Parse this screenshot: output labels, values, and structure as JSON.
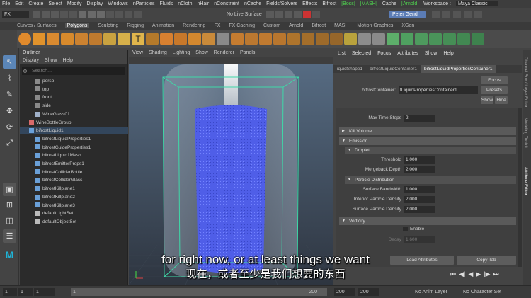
{
  "menubar": {
    "items": [
      "File",
      "Edit",
      "Create",
      "Select",
      "Modify",
      "Display",
      "Windows",
      "nParticles",
      "Fluids",
      "nCloth",
      "nHair",
      "nConstraint",
      "nCache",
      "Fields/Solvers",
      "Effects",
      "Bifrost"
    ],
    "plugins": [
      "[Boss]",
      "[MASH]"
    ],
    "cache": "Cache",
    "arnold": "[Arnold]",
    "workspace_label": "Workspace :",
    "workspace_value": "Maya Classic"
  },
  "status": {
    "mode": "FX",
    "live_surface": "No Live Surface",
    "user": "Peter Gend"
  },
  "shelf": {
    "tabs": [
      "Curves / Surfaces",
      "Polygons",
      "Sculpting",
      "Rigging",
      "Animation",
      "Rendering",
      "FX",
      "FX Caching",
      "Custom",
      "Arnold",
      "Bifrost",
      "MASH",
      "Motion Graphics",
      "XGen"
    ],
    "active_tab": "Polygons"
  },
  "outliner": {
    "title": "Outliner",
    "menu": [
      "Display",
      "Show",
      "Help"
    ],
    "search_placeholder": "Search...",
    "items": [
      {
        "label": "persp",
        "icon": "camera-icon",
        "color": "#8a8a8a"
      },
      {
        "label": "top",
        "icon": "camera-icon",
        "color": "#8a8a8a"
      },
      {
        "label": "front",
        "icon": "camera-icon",
        "color": "#8a8a8a"
      },
      {
        "label": "side",
        "icon": "camera-icon",
        "color": "#8a8a8a"
      },
      {
        "label": "WineGlass01",
        "icon": "mesh-icon",
        "color": "#9fb0c8"
      },
      {
        "label": "WineBottleGroup",
        "icon": "group-icon",
        "color": "#d96a6a"
      },
      {
        "label": "bifrostLiquid1",
        "icon": "liquid-icon",
        "color": "#6aa0d8"
      },
      {
        "label": "bifrostLiquidProperties1",
        "icon": "liquid-icon",
        "color": "#6aa0d8"
      },
      {
        "label": "bifrostGuideProperties1",
        "icon": "liquid-icon",
        "color": "#6aa0d8"
      },
      {
        "label": "bifrostLiquid1Mesh",
        "icon": "liquid-icon",
        "color": "#6aa0d8"
      },
      {
        "label": "bifrostEmitterProps1",
        "icon": "liquid-icon",
        "color": "#6aa0d8"
      },
      {
        "label": "bifrostColliderBottle",
        "icon": "liquid-icon",
        "color": "#6aa0d8"
      },
      {
        "label": "bifrostColliderGlass",
        "icon": "liquid-icon",
        "color": "#6aa0d8"
      },
      {
        "label": "bifrostKillplane1",
        "icon": "plane-icon",
        "color": "#6aa0d8"
      },
      {
        "label": "bifrostKillplane2",
        "icon": "plane-icon",
        "color": "#6aa0d8"
      },
      {
        "label": "bifrostKillplane3",
        "icon": "plane-icon",
        "color": "#6aa0d8"
      },
      {
        "label": "defaultLightSet",
        "icon": "set-icon",
        "color": "#bbbbbb"
      },
      {
        "label": "defaultObjectSet",
        "icon": "set-icon",
        "color": "#bbbbbb"
      }
    ]
  },
  "viewport": {
    "menu": [
      "View",
      "Shading",
      "Lighting",
      "Show",
      "Renderer",
      "Panels"
    ],
    "liquid_color": "#4f5ee8",
    "bbox_color": "#3fd9a8"
  },
  "attribute_editor": {
    "menu": [
      "List",
      "Selected",
      "Focus",
      "Attributes",
      "Show",
      "Help"
    ],
    "tabs": [
      "iquidShape1",
      "bifrostLiquidContainer1",
      "bifrostLiquidPropertiesContainer1"
    ],
    "active_tab": "bifrostLiquidPropertiesContainer1",
    "name_label": "bifrostContainer:",
    "name_value": "tLiquidPropertiesContainer1",
    "buttons": {
      "focus": "Focus",
      "presets": "Presets",
      "show": "Show",
      "hide": "Hide"
    },
    "max_time_steps_label": "Max Time Steps",
    "max_time_steps_value": "2",
    "sections": {
      "kill_volume": "Kill Volume",
      "emission": "Emission",
      "droplet": "Droplet",
      "particle_distribution": "Particle Distribution",
      "vorticity": "Vorticity"
    },
    "fields": {
      "threshold": {
        "label": "Threshold",
        "value": "1.000"
      },
      "mergeback_depth": {
        "label": "Mergeback Depth",
        "value": "2.000"
      },
      "surface_bandwidth": {
        "label": "Surface Bandwidth",
        "value": "1.000"
      },
      "interior_particle_density": {
        "label": "Interior Particle Density",
        "value": "2.000"
      },
      "surface_particle_density": {
        "label": "Surface Particle Density",
        "value": "2.000"
      },
      "enable": {
        "label": "Enable"
      },
      "decay": {
        "label": "Decay",
        "value": "1.600"
      }
    },
    "load_attributes": "Load Attributes",
    "copy_tab": "Copy Tab"
  },
  "side_tabs": [
    "Channel Box / Layer Editor",
    "Modeling Toolkit",
    "Attribute Editor"
  ],
  "timeline": {
    "start": "1",
    "current": "1",
    "range_start": "1",
    "range_end": "200",
    "end1": "200",
    "end2": "200",
    "anim_layer": "No Anim Layer",
    "character_set": "No Character Set"
  },
  "subtitles": {
    "en": "for right now, or at least things we want",
    "zh": "现在，或者至少是我们想要的东西"
  }
}
